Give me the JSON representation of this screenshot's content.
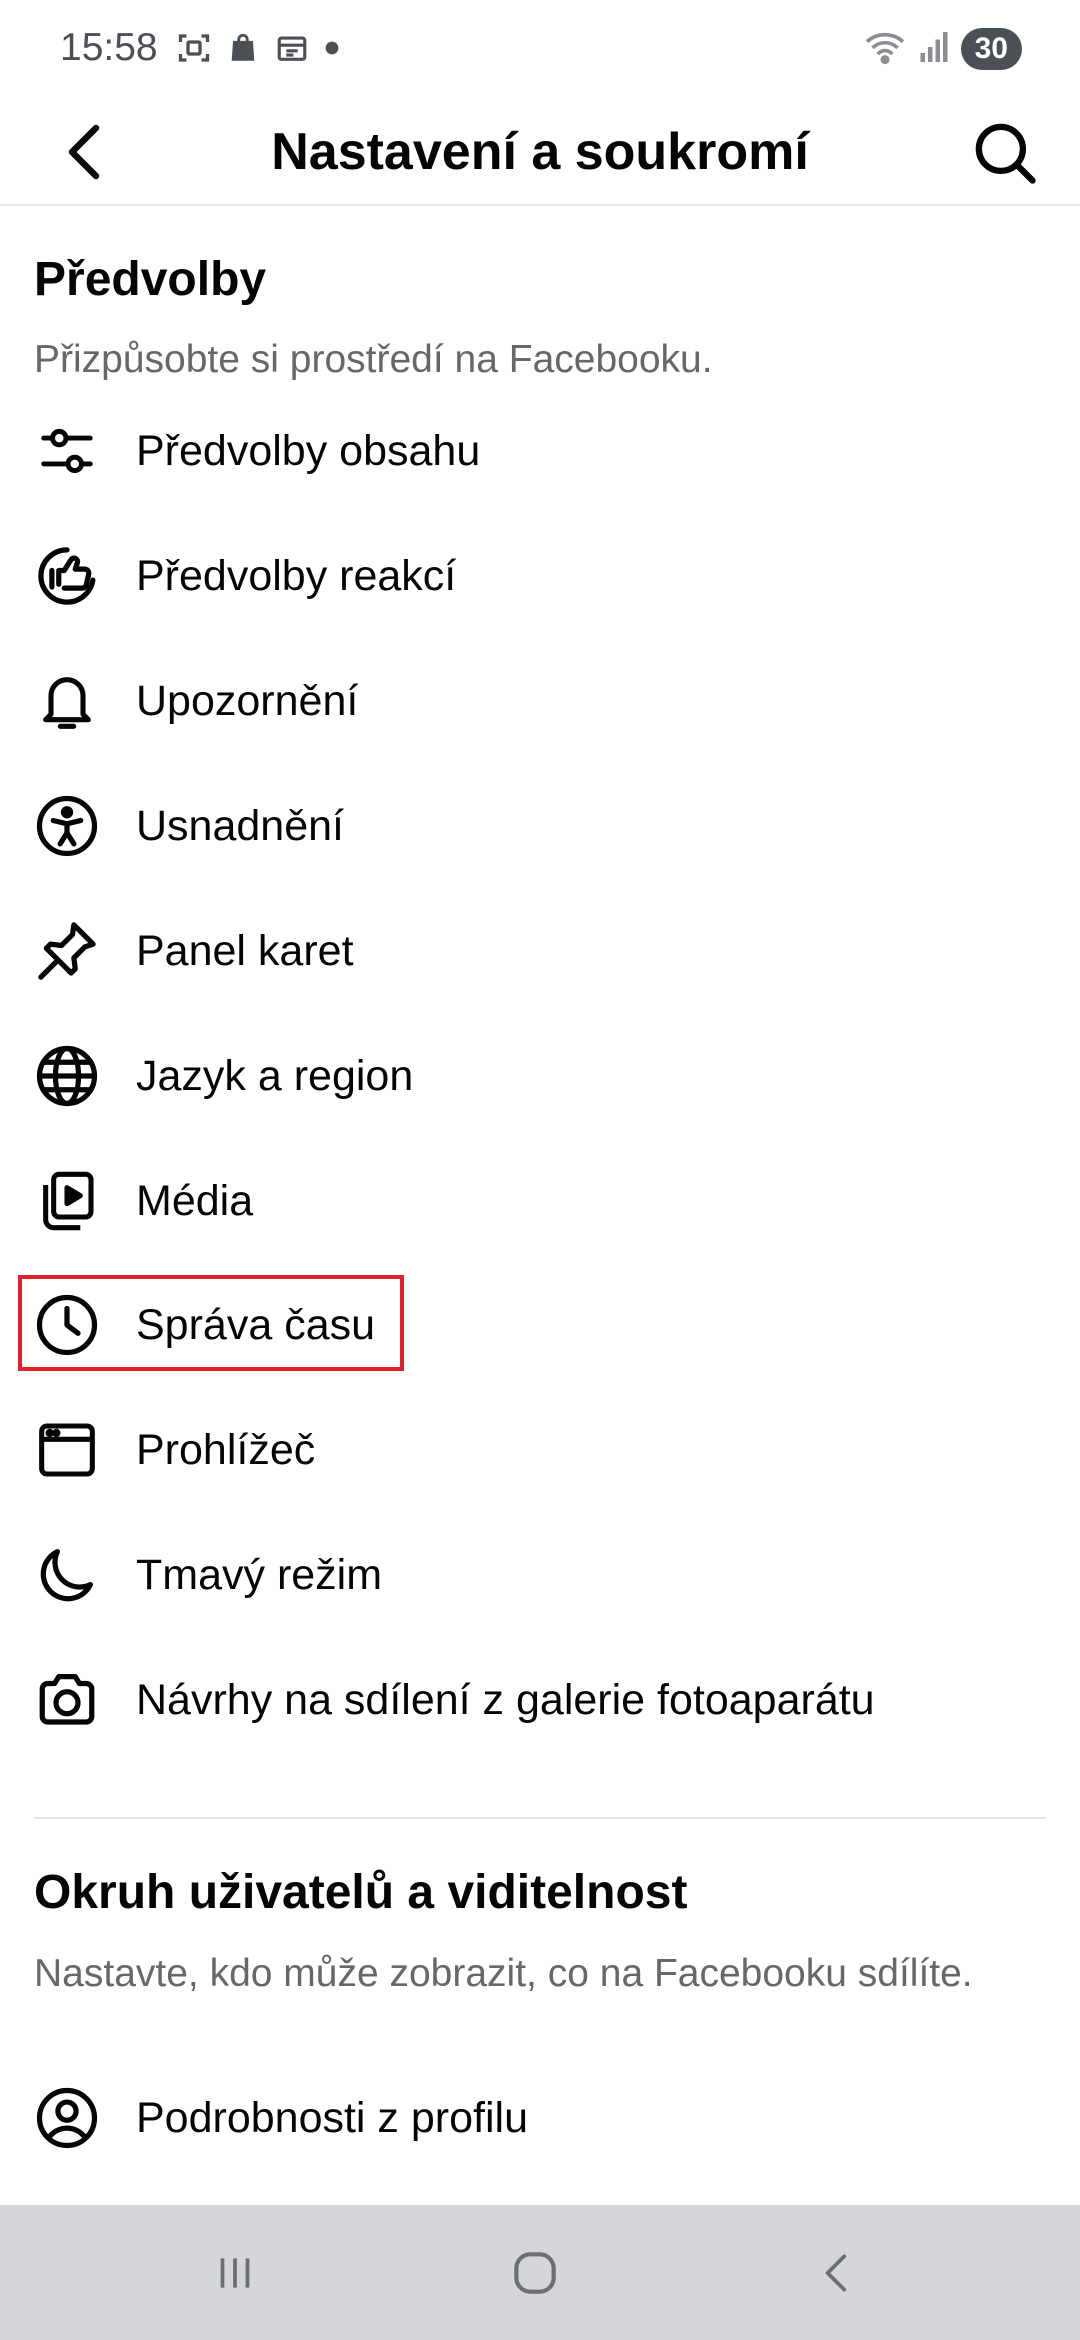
{
  "status_bar": {
    "time": "15:58",
    "battery": "30"
  },
  "header": {
    "title": "Nastavení a soukromí"
  },
  "sections": [
    {
      "title": "Předvolby",
      "subtitle": "Přizpůsobte si prostředí na Facebooku.",
      "items": [
        {
          "label": "Předvolby obsahu",
          "icon": "sliders-icon"
        },
        {
          "label": "Předvolby reakcí",
          "icon": "thumbs-up-reaction-icon"
        },
        {
          "label": "Upozornění",
          "icon": "bell-icon"
        },
        {
          "label": "Usnadnění",
          "icon": "accessibility-icon"
        },
        {
          "label": "Panel karet",
          "icon": "pin-icon"
        },
        {
          "label": "Jazyk a region",
          "icon": "globe-icon"
        },
        {
          "label": "Média",
          "icon": "media-icon"
        },
        {
          "label": "Správa času",
          "icon": "clock-icon"
        },
        {
          "label": "Prohlížeč",
          "icon": "browser-icon"
        },
        {
          "label": "Tmavý režim",
          "icon": "moon-icon"
        },
        {
          "label": "Návrhy na sdílení z galerie fotoaparátu",
          "icon": "camera-icon"
        }
      ]
    },
    {
      "title": "Okruh uživatelů a viditelnost",
      "subtitle": "Nastavte, kdo může zobrazit, co na Facebooku sdílíte.",
      "items": [
        {
          "label": "Podrobnosti z profilu",
          "icon": "profile-icon"
        }
      ]
    }
  ],
  "colors": {
    "highlight": "#e0202b",
    "text": "#050505",
    "secondary_text": "#65676b",
    "nav_bar": "#d4d6d9"
  }
}
